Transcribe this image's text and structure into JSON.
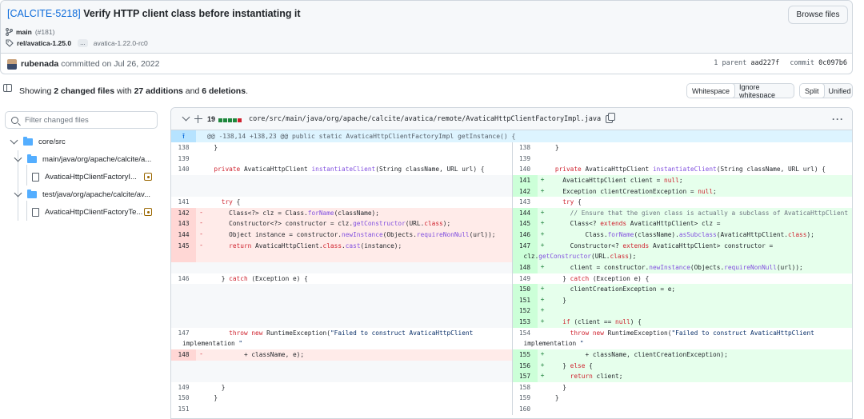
{
  "commit": {
    "issue": "[CALCITE-5218]",
    "title": "Verify HTTP client class before instantiating it",
    "browse_label": "Browse files",
    "branch": "main",
    "pr": "(#181)",
    "tag": "rel/avatica-1.25.0",
    "ellipsis": "...",
    "tag2": "avatica-1.22.0-rc0",
    "author": "rubenada",
    "date_text": "committed on Jul 26, 2022",
    "parent_label": "1 parent",
    "parent_sha": "aad227f",
    "commit_label": "commit",
    "commit_sha": "0c097b6"
  },
  "summary": {
    "prefix": "Showing ",
    "files": "2 changed files",
    "mid": " with ",
    "additions": "27 additions",
    "and": " and ",
    "deletions": "6 deletions",
    "end": "."
  },
  "view_controls": {
    "whitespace": "Whitespace",
    "ignore_whitespace": "Ignore whitespace",
    "split": "Split",
    "unified": "Unified"
  },
  "file_tree": {
    "filter_placeholder": "Filter changed files",
    "root": "core/src",
    "dir1": "main/java/org/apache/calcite/a...",
    "file1": "AvaticaHttpClientFactoryI...",
    "dir2": "test/java/org/apache/calcite/av...",
    "file2": "AvaticaHttpClientFactoryTe..."
  },
  "diff": {
    "change_count": "19",
    "file_path": "core/src/main/java/org/apache/calcite/avatica/remote/AvaticaHttpClientFactoryImpl.java",
    "hunk_header": "@@ -138,14 +138,23 @@ public static AvaticaHttpClientFactoryImpl getInstance() {",
    "colors": {
      "add": "#e6ffec",
      "del": "#ffebe9",
      "add_num": "#ccffd8",
      "del_num": "#ffd7d5"
    },
    "rows": [
      {
        "l": {
          "n": "138",
          "t": "ctx",
          "c": "  }"
        },
        "r": {
          "n": "138",
          "t": "ctx",
          "c": "  }"
        }
      },
      {
        "l": {
          "n": "139",
          "t": "ctx",
          "c": ""
        },
        "r": {
          "n": "139",
          "t": "ctx",
          "c": ""
        }
      },
      {
        "l": {
          "n": "140",
          "t": "ctx",
          "c": "  private AvaticaHttpClient instantiateClient(String className, URL url) {"
        },
        "r": {
          "n": "140",
          "t": "ctx",
          "c": "  private AvaticaHttpClient instantiateClient(String className, URL url) {"
        }
      },
      {
        "l": {
          "n": "",
          "t": "empty",
          "c": ""
        },
        "r": {
          "n": "141",
          "t": "add",
          "c": "    AvaticaHttpClient client = null;"
        }
      },
      {
        "l": {
          "n": "",
          "t": "empty",
          "c": ""
        },
        "r": {
          "n": "142",
          "t": "add",
          "c": "    Exception clientCreationException = null;"
        }
      },
      {
        "l": {
          "n": "141",
          "t": "ctx",
          "c": "    try {"
        },
        "r": {
          "n": "143",
          "t": "ctx",
          "c": "    try {"
        }
      },
      {
        "l": {
          "n": "142",
          "t": "del",
          "c": "      Class<?> clz = Class.forName(className);"
        },
        "r": {
          "n": "144",
          "t": "add",
          "c": "      // Ensure that the given class is actually a subclass of AvaticaHttpClient"
        }
      },
      {
        "l": {
          "n": "143",
          "t": "del",
          "c": "      Constructor<?> constructor = clz.getConstructor(URL.class);"
        },
        "r": {
          "n": "145",
          "t": "add",
          "c": "      Class<? extends AvaticaHttpClient> clz ="
        }
      },
      {
        "l": {
          "n": "144",
          "t": "del",
          "c": "      Object instance = constructor.newInstance(Objects.requireNonNull(url));"
        },
        "r": {
          "n": "146",
          "t": "add",
          "c": "          Class.forName(className).asSubclass(AvaticaHttpClient.class);"
        }
      },
      {
        "l": {
          "n": "145",
          "t": "del",
          "c": "      return AvaticaHttpClient.class.cast(instance);"
        },
        "r": {
          "n": "147",
          "t": "add",
          "c": "      Constructor<? extends AvaticaHttpClient> constructor ="
        }
      },
      {
        "l": {
          "n": "",
          "t": "delcont",
          "c": ""
        },
        "r": {
          "n": "",
          "t": "addcont",
          "c": "clz.getConstructor(URL.class);"
        }
      },
      {
        "l": {
          "n": "",
          "t": "empty",
          "c": ""
        },
        "r": {
          "n": "148",
          "t": "add",
          "c": "      client = constructor.newInstance(Objects.requireNonNull(url));"
        }
      },
      {
        "l": {
          "n": "146",
          "t": "ctx",
          "c": "    } catch (Exception e) {"
        },
        "r": {
          "n": "149",
          "t": "ctx",
          "c": "    } catch (Exception e) {"
        }
      },
      {
        "l": {
          "n": "",
          "t": "empty",
          "c": ""
        },
        "r": {
          "n": "150",
          "t": "add",
          "c": "      clientCreationException = e;"
        }
      },
      {
        "l": {
          "n": "",
          "t": "empty",
          "c": ""
        },
        "r": {
          "n": "151",
          "t": "add",
          "c": "    }"
        }
      },
      {
        "l": {
          "n": "",
          "t": "empty",
          "c": ""
        },
        "r": {
          "n": "152",
          "t": "add",
          "c": ""
        }
      },
      {
        "l": {
          "n": "",
          "t": "empty",
          "c": ""
        },
        "r": {
          "n": "153",
          "t": "add",
          "c": "    if (client == null) {"
        }
      },
      {
        "l": {
          "n": "147",
          "t": "ctx",
          "c": "      throw new RuntimeException(\"Failed to construct AvaticaHttpClient"
        },
        "r": {
          "n": "154",
          "t": "ctx",
          "c": "      throw new RuntimeException(\"Failed to construct AvaticaHttpClient"
        }
      },
      {
        "l": {
          "n": "",
          "t": "ctxcont",
          "c": "implementation \""
        },
        "r": {
          "n": "",
          "t": "ctxcont",
          "c": "implementation \""
        }
      },
      {
        "l": {
          "n": "148",
          "t": "del",
          "c": "          + className, e);"
        },
        "r": {
          "n": "155",
          "t": "add",
          "c": "          + className, clientCreationException);"
        }
      },
      {
        "l": {
          "n": "",
          "t": "empty",
          "c": ""
        },
        "r": {
          "n": "156",
          "t": "add",
          "c": "    } else {"
        }
      },
      {
        "l": {
          "n": "",
          "t": "empty",
          "c": ""
        },
        "r": {
          "n": "157",
          "t": "add",
          "c": "      return client;"
        }
      },
      {
        "l": {
          "n": "149",
          "t": "ctx",
          "c": "    }"
        },
        "r": {
          "n": "158",
          "t": "ctx",
          "c": "    }"
        }
      },
      {
        "l": {
          "n": "150",
          "t": "ctx",
          "c": "  }"
        },
        "r": {
          "n": "159",
          "t": "ctx",
          "c": "  }"
        }
      },
      {
        "l": {
          "n": "151",
          "t": "ctx",
          "c": ""
        },
        "r": {
          "n": "160",
          "t": "ctx",
          "c": ""
        }
      }
    ]
  }
}
